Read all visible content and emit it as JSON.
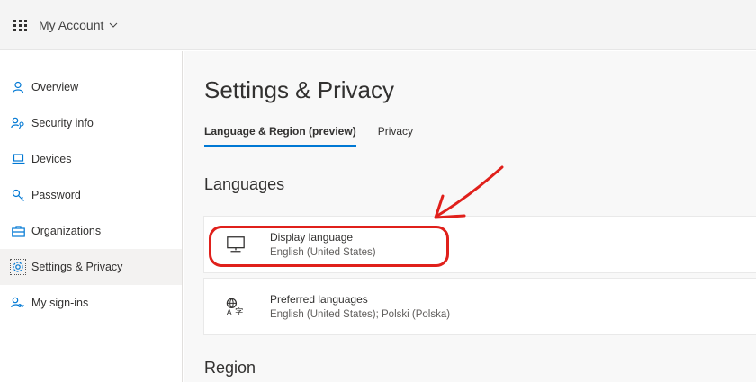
{
  "header": {
    "app_title": "My Account"
  },
  "sidebar": {
    "items": [
      {
        "label": "Overview",
        "icon": "person-icon"
      },
      {
        "label": "Security info",
        "icon": "key-person-icon"
      },
      {
        "label": "Devices",
        "icon": "laptop-icon"
      },
      {
        "label": "Password",
        "icon": "key-icon"
      },
      {
        "label": "Organizations",
        "icon": "briefcase-icon"
      },
      {
        "label": "Settings & Privacy",
        "icon": "gear-icon",
        "active": true
      },
      {
        "label": "My sign-ins",
        "icon": "person-key-icon"
      }
    ]
  },
  "main": {
    "title": "Settings & Privacy",
    "tabs": [
      {
        "label": "Language & Region (preview)",
        "active": true
      },
      {
        "label": "Privacy",
        "active": false
      }
    ],
    "sections": {
      "languages": "Languages",
      "region": "Region"
    },
    "cards": {
      "display_language": {
        "title": "Display language",
        "value": "English (United States)",
        "icon": "monitor-icon"
      },
      "preferred_languages": {
        "title": "Preferred languages",
        "value": "English (United States); Polski (Polska)",
        "icon": "translate-icon"
      }
    }
  },
  "colors": {
    "accent": "#0078d4",
    "annotation": "#e0201b",
    "sidebar_icon": "#0078d4"
  }
}
